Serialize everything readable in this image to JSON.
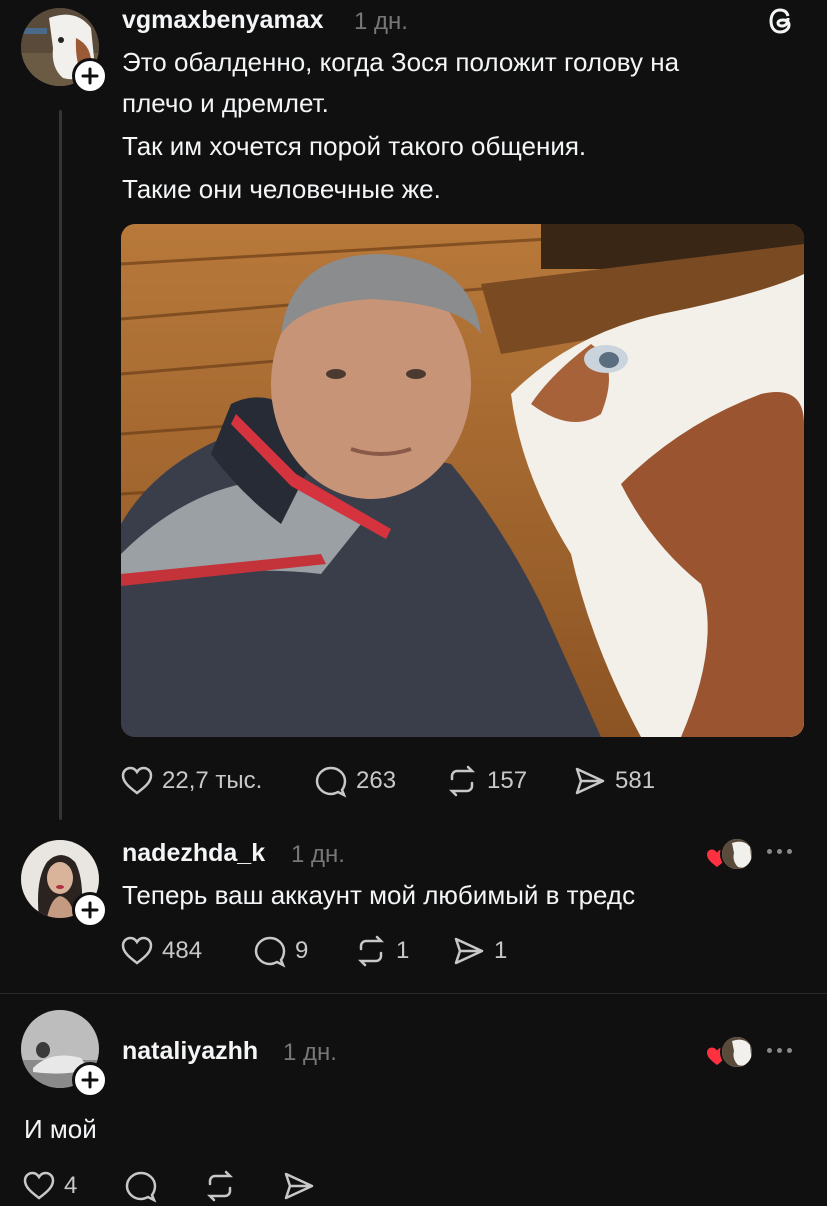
{
  "app": {
    "logo_icon": "threads-icon"
  },
  "post": {
    "username": "vgmaxbenyamax",
    "time": "1 дн.",
    "lines": [
      "Это обалденно, когда Зося положит голову на",
      "плечо и дремлет.",
      "Так им хочется порой такого общения.",
      "Такие они человечные же."
    ],
    "image_alt": "man-and-cow-photo",
    "actions": {
      "likes": "22,7 тыс.",
      "replies": "263",
      "reposts": "157",
      "shares": "581"
    }
  },
  "replies": [
    {
      "username": "nadezhda_k",
      "time": "1 дн.",
      "text": "Теперь ваш аккаунт мой любимый в тредс",
      "actions": {
        "likes": "484",
        "replies": "9",
        "reposts": "1",
        "shares": "1"
      }
    },
    {
      "username": "nataliyazhh",
      "time": "1 дн.",
      "text": "И мой",
      "actions": {
        "likes": "4",
        "replies": "",
        "reposts": "",
        "shares": ""
      }
    }
  ],
  "colors": {
    "background": "#101010",
    "text": "#f3f5f7",
    "muted": "#777777",
    "heart": "#ff3040"
  }
}
